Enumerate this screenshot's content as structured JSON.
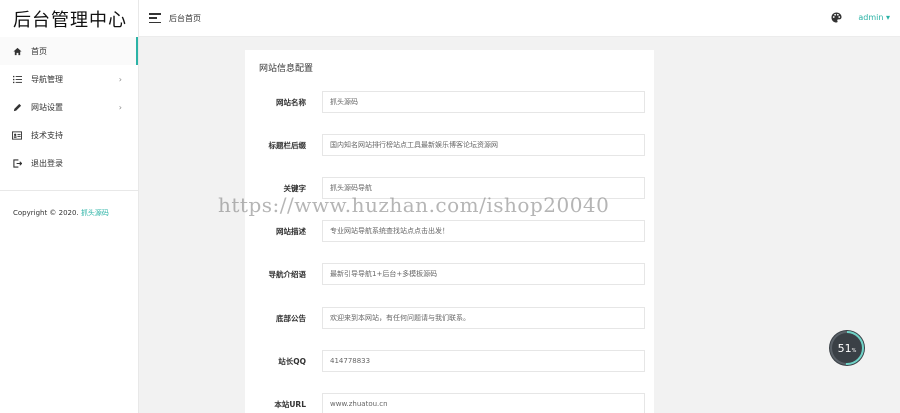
{
  "app": {
    "logo_text": "后台管理中心"
  },
  "sidebar": {
    "items": [
      {
        "label": "首页",
        "icon": "home-icon"
      },
      {
        "label": "导航管理",
        "icon": "list-icon"
      },
      {
        "label": "网站设置",
        "icon": "pencil-icon"
      },
      {
        "label": "技术支持",
        "icon": "id-card-icon"
      },
      {
        "label": "退出登录",
        "icon": "logout-icon"
      }
    ],
    "copyright_prefix": "Copyright © 2020.",
    "copyright_brand": "抓头源码"
  },
  "header": {
    "crumb": "后台首页",
    "user": "admin ▾"
  },
  "form": {
    "title": "网站信息配置",
    "fields": [
      {
        "label": "网站名称",
        "value": "抓头源码"
      },
      {
        "label": "标题栏后缀",
        "value": "国内知名网站排行榜站点工具最新娱乐博客论坛资源网"
      },
      {
        "label": "关键字",
        "value": "抓头源码导航"
      },
      {
        "label": "网站描述",
        "value": "专业网站导航系统查找站点点击出发！"
      },
      {
        "label": "导航介绍语",
        "value": "最新引导导航1+后台+多模板源码"
      },
      {
        "label": "底部公告",
        "value": "欢迎来到本网站，有任何问题请与我们联系。"
      },
      {
        "label": "站长QQ",
        "value": "414778833"
      },
      {
        "label": "本站URL",
        "value": "www.zhuatou.cn"
      }
    ]
  },
  "watermark": "https://www.huzhan.com/ishop20040",
  "progress": {
    "value": "51",
    "unit": "%",
    "fraction": 0.51
  },
  "colors": {
    "accent": "#2bb3a6"
  }
}
